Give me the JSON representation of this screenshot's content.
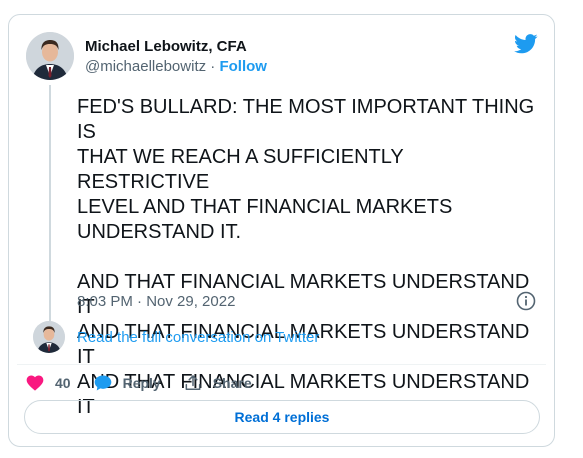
{
  "author": {
    "name": "Michael Lebowitz, CFA",
    "handle": "@michaellebowitz",
    "separator": "·",
    "follow_label": "Follow",
    "avatar_icon": "profile-photo"
  },
  "tweet": {
    "paragraph_1": "FED'S BULLARD: THE MOST IMPORTANT THING IS\nTHAT WE REACH A SUFFICIENTLY RESTRICTIVE\nLEVEL AND THAT FINANCIAL MARKETS\nUNDERSTAND IT.",
    "paragraph_2": "AND THAT FINANCIAL MARKETS UNDERSTAND IT\nAND THAT FINANCIAL MARKETS UNDERSTAND IT\nAND THAT FINANCIAL MARKETS UNDERSTAND IT",
    "timestamp": "8:03 PM · Nov 29, 2022"
  },
  "conversation": {
    "link_label": "Read the full conversation on Twitter"
  },
  "actions": {
    "like_count": "40",
    "reply_label": "Reply",
    "share_label": "Share"
  },
  "replies": {
    "button_label": "Read 4 replies"
  },
  "colors": {
    "accent": "#1d9bf0",
    "like": "#f91880",
    "text": "#0f1419",
    "secondary": "#536471",
    "border": "#cfd9de"
  }
}
